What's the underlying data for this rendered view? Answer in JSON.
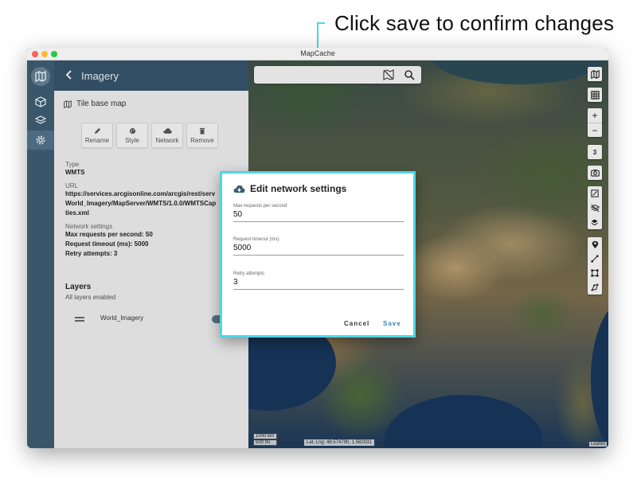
{
  "callout": {
    "text": "Click save to confirm changes"
  },
  "window": {
    "title": "MapCache"
  },
  "panel": {
    "title": "Imagery",
    "tile_label": "Tile base map",
    "actions": [
      {
        "label": "Rename",
        "icon": "pencil-icon"
      },
      {
        "label": "Style",
        "icon": "palette-icon"
      },
      {
        "label": "Network",
        "icon": "cloud-icon"
      },
      {
        "label": "Remove",
        "icon": "trash-icon"
      }
    ],
    "type_label": "Type",
    "type_value": "WMTS",
    "url_label": "URL",
    "url_lines": [
      "https://services.arcgisonline.com/arcgis/rest/serv",
      "World_Imagery/MapServer/WMTS/1.0.0/WMTSCap",
      "ties.xml"
    ],
    "network_label": "Network settings",
    "network_lines": [
      "Max requests per second: 50",
      "Request timeout (ms): 5000",
      "Retry attempts: 3"
    ],
    "layers_title": "Layers",
    "layers_sub": "All layers enabled",
    "layer_name": "World_Imagery"
  },
  "map": {
    "scale_km": "1000 km",
    "scale_mi": "500 mi",
    "coords": "Lat, Lng: 48.574790, 1.582031",
    "attribution": "Leaflet",
    "zoom_level": "3"
  },
  "dialog": {
    "title": "Edit network settings",
    "fields": [
      {
        "label": "Max requests per second",
        "value": "50"
      },
      {
        "label": "Request timeout (ms)",
        "value": "5000"
      },
      {
        "label": "Retry attempts",
        "value": "3"
      }
    ],
    "cancel_label": "Cancel",
    "save_label": "Save",
    "accent_color": "#4dd6e6",
    "save_color": "#3c7fb8"
  }
}
